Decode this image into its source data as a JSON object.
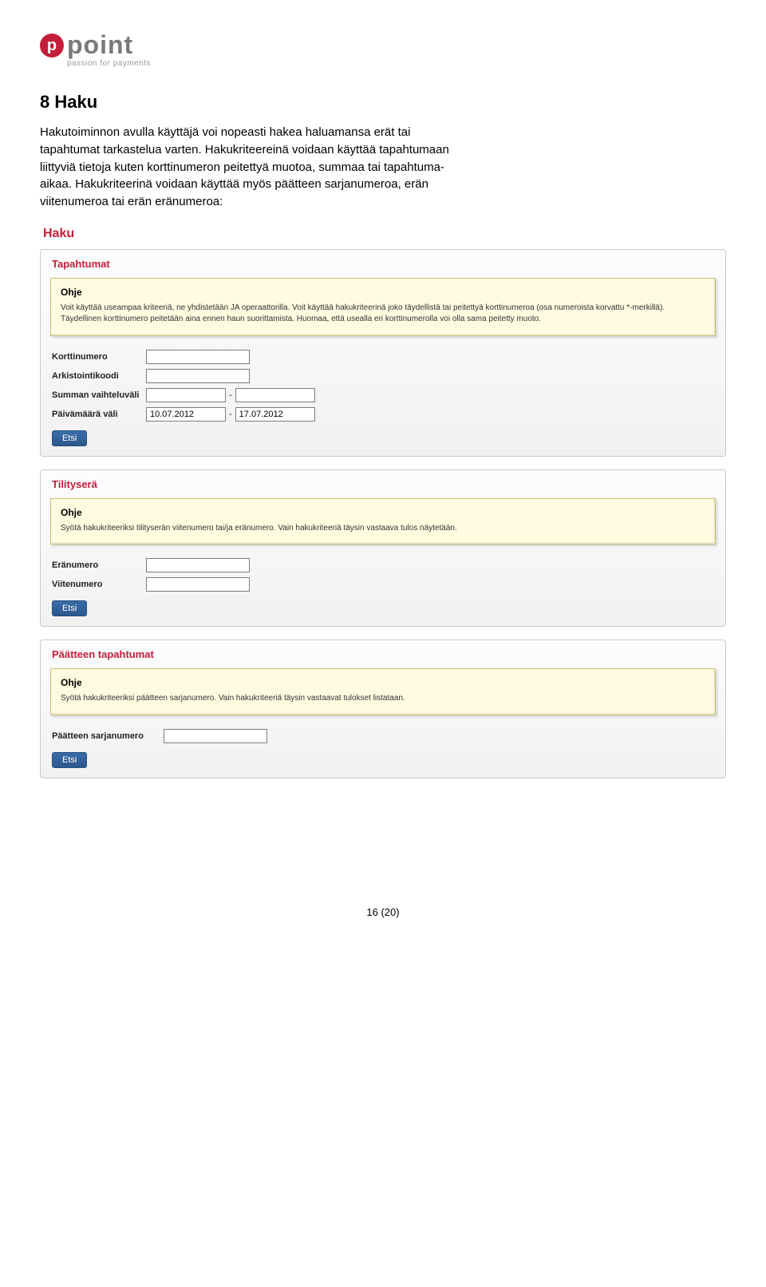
{
  "logo": {
    "word": "point",
    "tagline": "passion for payments"
  },
  "heading": "8   Haku",
  "paragraph": "Hakutoiminnon avulla käyttäjä voi nopeasti hakea haluamansa erät tai tapahtumat tarkastelua varten. Hakukriteereinä voidaan käyttää tapahtumaan liittyviä tietoja kuten korttinumeron peitettyä muotoa, summaa tai tapahtuma-aikaa. Hakukriteerinä voidaan käyttää myös päätteen sarjanumeroa, erän viitenumeroa tai erän eränumeroa:",
  "app_title": "Haku",
  "panel1": {
    "title": "Tapahtumat",
    "ohje_title": "Ohje",
    "ohje_text": "Voit käyttää useampaa kriteeriä, ne yhdistetään JA operaattorilla. Voit käyttää hakukriteerinä joko täydellistä tai peitettyä korttinumeroa (osa numeroista korvattu *-merkillä). Täydellinen korttinumero peitetään aina ennen haun suorittamista. Huomaa, että usealla eri korttinumerolla voi olla sama peitetty muoto.",
    "fields": {
      "korttinumero": "Korttinumero",
      "arkistointikoodi": "Arkistointikoodi",
      "summa": "Summan vaihteluväli",
      "paivamaara": "Päivämäärä väli",
      "date_from": "10.07.2012",
      "date_to": "17.07.2012"
    },
    "btn": "Etsi"
  },
  "panel2": {
    "title": "Tilityserä",
    "ohje_title": "Ohje",
    "ohje_text": "Syötä hakukriteeriksi tilityserän viitenumero tai/ja eränumero. Vain hakukriteeriä täysin vastaava tulos näytetään.",
    "fields": {
      "eranumero": "Eränumero",
      "viitenumero": "Viitenumero"
    },
    "btn": "Etsi"
  },
  "panel3": {
    "title": "Päätteen tapahtumat",
    "ohje_title": "Ohje",
    "ohje_text": "Syötä hakukriteeriksi päätteen sarjanumero. Vain hakukriteeriä täysin vastaavat tulokset listataan.",
    "fields": {
      "sarja": "Päätteen sarjanumero"
    },
    "btn": "Etsi"
  },
  "page_num": "16 (20)"
}
